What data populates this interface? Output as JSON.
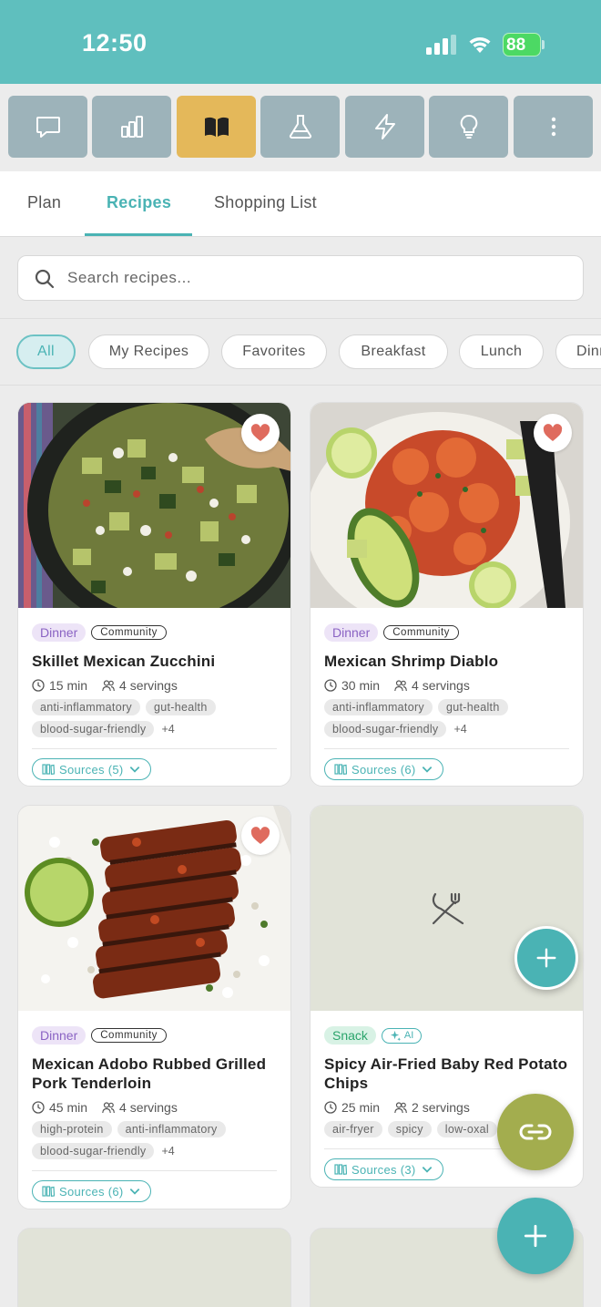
{
  "status_bar": {
    "time": "12:50",
    "battery": "88"
  },
  "toolbar": {
    "buttons": [
      {
        "icon": "chat-bubble-icon"
      },
      {
        "icon": "bar-chart-icon"
      },
      {
        "icon": "open-book-icon",
        "active": true
      },
      {
        "icon": "flask-icon"
      },
      {
        "icon": "lightning-icon"
      },
      {
        "icon": "lightbulb-icon"
      },
      {
        "icon": "more-vertical-icon"
      }
    ]
  },
  "tabs": [
    {
      "label": "Plan"
    },
    {
      "label": "Recipes",
      "active": true
    },
    {
      "label": "Shopping List"
    }
  ],
  "search": {
    "placeholder": "Search recipes..."
  },
  "filters": [
    "All",
    "My Recipes",
    "Favorites",
    "Breakfast",
    "Lunch",
    "Dinner"
  ],
  "recipes": [
    {
      "category": "Dinner",
      "source_badge": "Community",
      "title": "Skillet Mexican Zucchini",
      "time": "15 min",
      "servings": "4 servings",
      "tags": [
        "anti-inflammatory",
        "gut-health",
        "blood-sugar-friendly"
      ],
      "more": "+4",
      "sources": "Sources (5)",
      "favorite": true
    },
    {
      "category": "Dinner",
      "source_badge": "Community",
      "title": "Mexican Shrimp Diablo",
      "time": "30 min",
      "servings": "4 servings",
      "tags": [
        "anti-inflammatory",
        "gut-health",
        "blood-sugar-friendly"
      ],
      "more": "+4",
      "sources": "Sources (6)",
      "favorite": true
    },
    {
      "category": "Dinner",
      "source_badge": "Community",
      "title": "Mexican Adobo Rubbed Grilled Pork Tenderloin",
      "time": "45 min",
      "servings": "4 servings",
      "tags": [
        "high-protein",
        "anti-inflammatory",
        "blood-sugar-friendly"
      ],
      "more": "+4",
      "sources": "Sources (6)",
      "favorite": true
    },
    {
      "category": "Snack",
      "source_badge": "AI",
      "title": "Spicy Air-Fried Baby Red Potato Chips",
      "time": "25 min",
      "servings": "2 servings",
      "tags": [
        "air-fryer",
        "spicy",
        "low-oxal"
      ],
      "sources": "Sources (3)",
      "placeholder_icon": "utensils-crossed-icon"
    }
  ],
  "colors": {
    "header": "#5fbfbe",
    "accent": "#4ab3b4",
    "active_tool": "#e4b85a",
    "tool": "#9db3ba",
    "link_fab": "#a3ad4e"
  }
}
